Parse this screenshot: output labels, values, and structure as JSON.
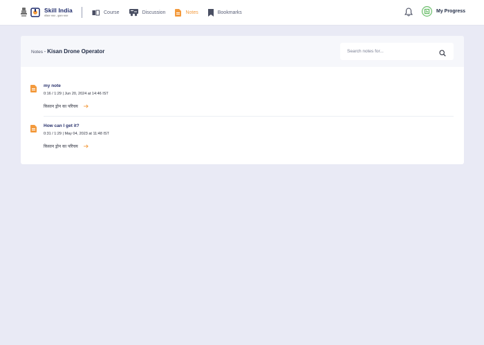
{
  "brand": {
    "title_skill": "Skill",
    "title_india": "India",
    "subtitle": "कौशल भारत - कुशल भारत"
  },
  "nav": {
    "items": [
      {
        "label": "Course",
        "icon": "book-open-icon",
        "active": false
      },
      {
        "label": "Discussion",
        "icon": "discussion-icon",
        "active": false
      },
      {
        "label": "Notes",
        "icon": "note-icon",
        "active": true
      },
      {
        "label": "Bookmarks",
        "icon": "bookmark-icon",
        "active": false
      }
    ],
    "progress_label": "My Progress"
  },
  "page": {
    "crumb_root": "Notes",
    "crumb_sep": " - ",
    "course_title": "Kisan Drone Operator"
  },
  "search": {
    "placeholder": "Search notes for..."
  },
  "notes": [
    {
      "title": "my note",
      "meta": "0:16 / 1:29 | Jun 20, 2024 at 14:46 IST",
      "lesson": "किसान ड्रोन का परिचय"
    },
    {
      "title": "How can I get it?",
      "meta": "0:31 / 1:29 | May 04, 2023 at 11:48 IST",
      "lesson": "किसान ड्रोन का परिचय"
    }
  ],
  "colors": {
    "accent": "#f39a3d",
    "background": "#e9eaf5",
    "brand_navy": "#1d2a6b",
    "progress_green": "#5cb85c"
  }
}
